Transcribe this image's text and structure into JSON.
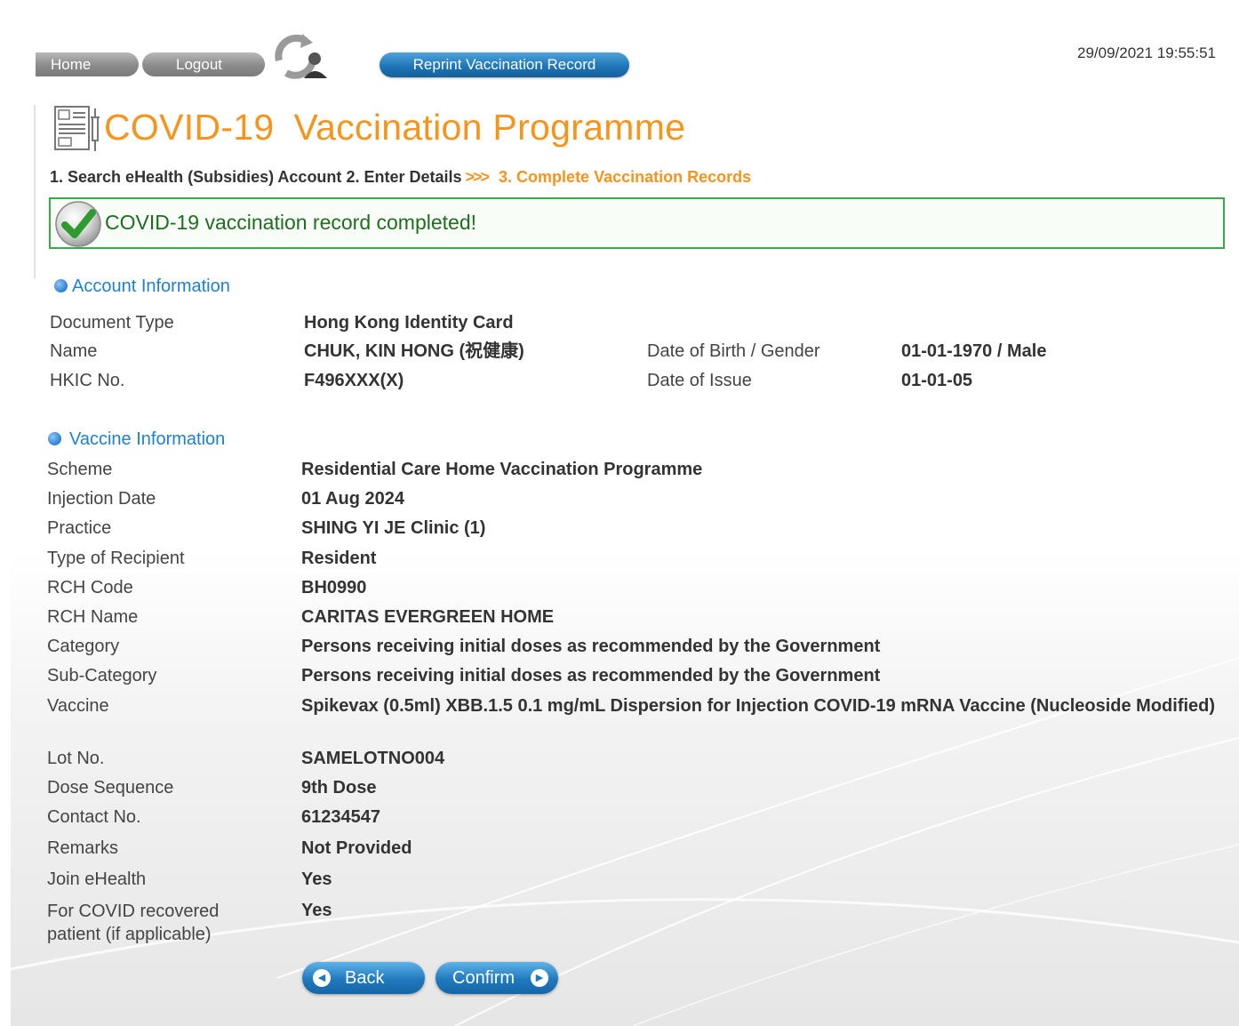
{
  "nav": {
    "home_label": "Home",
    "logout_label": "Logout",
    "reprint_label": "Reprint Vaccination Record",
    "datetime": "29/09/2021 19:55:51"
  },
  "header": {
    "title_part1": "COVID-19",
    "title_part2": "Vaccination Programme"
  },
  "steps": {
    "step1": "1. Search eHealth (Subsidies) Account",
    "step2": "2. Enter Details",
    "arrows": ">>>",
    "step3": "3. Complete Vaccination Records"
  },
  "message": {
    "text": "COVID-19 vaccination record completed!"
  },
  "account": {
    "heading": "Account Information",
    "document_type_label": "Document Type",
    "document_type_value": "Hong Kong Identity Card",
    "name_label": "Name",
    "name_value": "CHUK, KIN HONG (祝健康)",
    "dob_label": "Date of Birth / Gender",
    "dob_value": "01-01-1970 / Male",
    "hkic_label": "HKIC No.",
    "hkic_value": "F496XXX(X)",
    "issue_label": "Date of Issue",
    "issue_value": "01-01-05"
  },
  "vaccine": {
    "heading": "Vaccine Information",
    "scheme_label": "Scheme",
    "scheme_value": "Residential Care Home Vaccination Programme",
    "injection_date_label": "Injection Date",
    "injection_date_value": "01 Aug 2024",
    "practice_label": "Practice",
    "practice_value": "SHING YI JE Clinic (1)",
    "recipient_label": "Type of Recipient",
    "recipient_value": "Resident",
    "rch_code_label": "RCH Code",
    "rch_code_value": "BH0990",
    "rch_name_label": "RCH Name",
    "rch_name_value": "CARITAS EVERGREEN HOME",
    "category_label": "Category",
    "category_value": "Persons receiving initial doses as recommended by the Government",
    "subcategory_label": "Sub-Category",
    "subcategory_value": "Persons receiving initial doses as recommended by the Government",
    "vaccine_label": "Vaccine",
    "vaccine_value": "Spikevax (0.5ml) XBB.1.5 0.1 mg/mL Dispersion for Injection COVID-19 mRNA Vaccine (Nucleoside Modified)",
    "lot_label": "Lot No.",
    "lot_value": "SAMELOTNO004",
    "dose_label": "Dose Sequence",
    "dose_value": "9th Dose",
    "contact_label": "Contact No.",
    "contact_value": "61234547",
    "remarks_label": "Remarks",
    "remarks_value": "Not Provided",
    "join_label": "Join eHealth",
    "join_value": "Yes",
    "recovered_label": "For COVID recovered patient (if applicable)",
    "recovered_value": "Yes"
  },
  "actions": {
    "back_label": "Back",
    "confirm_label": "Confirm"
  },
  "colors": {
    "accent_orange": "#f7941d",
    "heading_blue": "#1f7fd1",
    "button_blue": "#1f79bd",
    "success_green": "#3da84a"
  }
}
